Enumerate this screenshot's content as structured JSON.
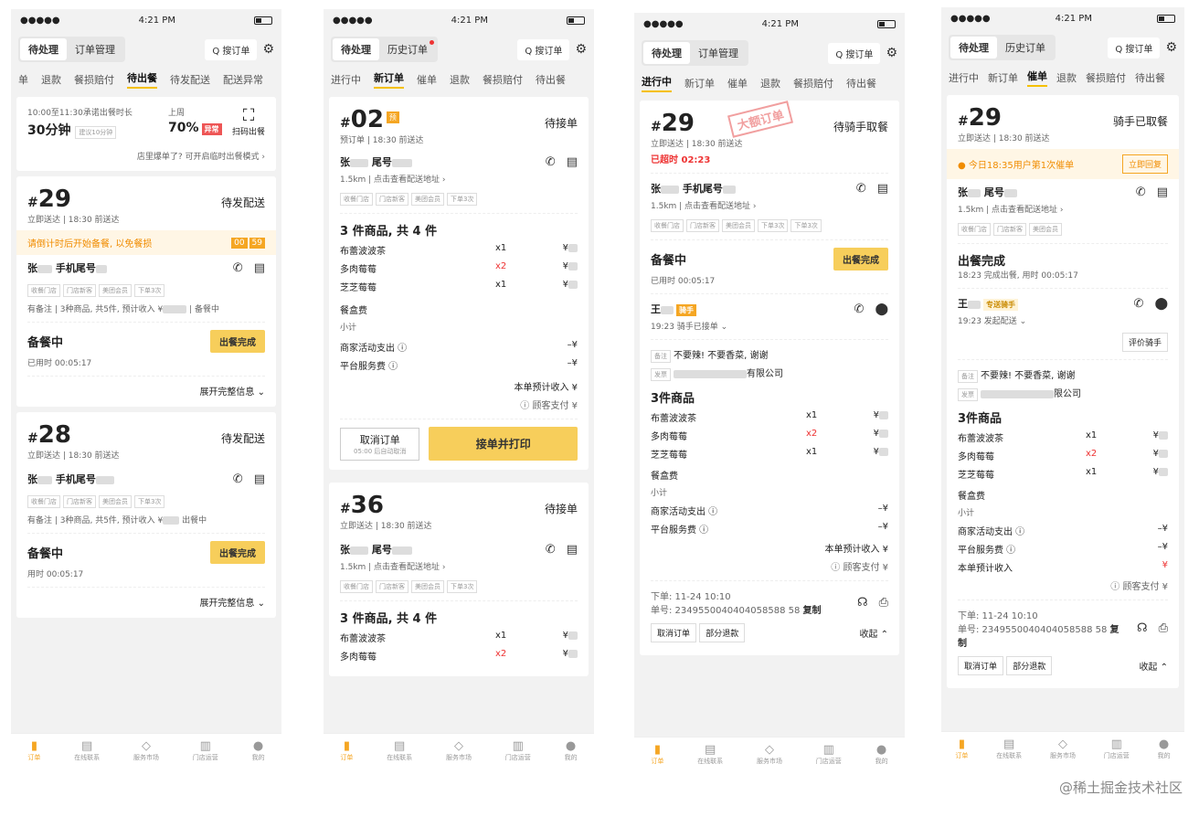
{
  "status": {
    "carrier": "●●●●●",
    "time": "4:21 PM"
  },
  "header": {
    "tab_pending": "待处理",
    "tab_orders": "订单管理",
    "tab_history": "历史订单",
    "search": "Q 搜订单",
    "gear": "⚙"
  },
  "nav": [
    "订单",
    "在线联系",
    "服务市场",
    "门店运营",
    "我的"
  ],
  "phone1": {
    "tabs": [
      "单",
      "退款",
      "餐损赔付",
      "待出餐",
      "待发配送",
      "配送异常"
    ],
    "promise_text": "10:00至11:30承诺出餐时长",
    "promise_value": "30分钟",
    "promise_suggest": "建议10分钟",
    "week_label": "上周",
    "week_value": "70%",
    "week_badge": "异常",
    "scan_label": "扫码出餐",
    "busy_text": "店里爆单了? 可开启临时出餐模式 ›",
    "order1": {
      "no": "29",
      "status": "待发配送",
      "sub": "立即送达 | 18:30 前送达",
      "warn": "请倒计时后开始备餐, 以免餐损",
      "t1": "00",
      "t2": "59",
      "name_a": "张",
      "name_b": "手机尾号",
      "tags": [
        "收餐门店",
        "门店新客",
        "美团会员",
        "下单3次"
      ],
      "note": "有备注 | 3种商品, 共5件, 预计收入 ¥",
      "note_tail": "| 备餐中",
      "prep": "备餐中",
      "prep_btn": "出餐完成",
      "elapsed": "已用时 00:05:17",
      "expand": "展开完整信息 ⌄"
    },
    "order2": {
      "no": "28",
      "status": "待发配送",
      "sub": "立即送达 | 18:30 前送达",
      "name_a": "张",
      "name_b": "手机尾号",
      "tags": [
        "收餐门店",
        "门店新客",
        "美团会员",
        "下单3次"
      ],
      "note": "有备注 | 3种商品, 共5件, 预计收入 ¥",
      "note_tail": "出餐中",
      "prep": "备餐中",
      "prep_btn": "出餐完成",
      "elapsed": "用时 00:05:17",
      "expand": "展开完整信息 ⌄"
    }
  },
  "phone2": {
    "tabs": [
      "进行中",
      "新订单",
      "催单",
      "退款",
      "餐损赔付",
      "待出餐"
    ],
    "order1": {
      "no": "02",
      "badge": "预",
      "status": "待接单",
      "sub": "预订单 | 18:30 前送达",
      "name_a": "张",
      "name_b": "尾号",
      "dist": "1.5km | 点击查看配送地址 ›",
      "tags": [
        "收餐门店",
        "门店新客",
        "美团会员",
        "下单3次"
      ],
      "goods_title": "3 件商品, 共 4 件",
      "goods": [
        {
          "n": "布蕾波波茶",
          "q": "x1"
        },
        {
          "n": "多肉莓莓",
          "q": "x2"
        },
        {
          "n": "芝芝莓莓",
          "q": "x1"
        }
      ],
      "box": "餐盒费",
      "subtotal": "小计",
      "activity": "商家活动支出 ⓘ",
      "service": "平台服务费 ⓘ",
      "income": "本单预计收入 ¥",
      "paid": "ⓘ 顾客支付 ¥",
      "cancel": "取消订单",
      "cancel_sub": "05:00 后自动取消",
      "accept": "接单并打印"
    },
    "order2": {
      "no": "36",
      "status": "待接单",
      "sub": "立即送达 | 18:30 前送达",
      "name_a": "张",
      "name_b": "尾号",
      "dist": "1.5km | 点击查看配送地址 ›",
      "tags": [
        "收餐门店",
        "门店新客",
        "美团会员",
        "下单3次"
      ],
      "goods_title": "3 件商品, 共 4 件",
      "goods": [
        {
          "n": "布蕾波波茶",
          "q": "x1"
        },
        {
          "n": "多肉莓莓",
          "q": "x2"
        }
      ]
    }
  },
  "phone3": {
    "tabs": [
      "进行中",
      "新订单",
      "催单",
      "退款",
      "餐损赔付",
      "待出餐"
    ],
    "no": "29",
    "stamp": "大额订单",
    "status": "待骑手取餐",
    "sub": "立即送达 | 18:30 前送达",
    "overtime": "已超时 02:23",
    "name_a": "张",
    "name_b": "手机尾号",
    "dist": "1.5km | 点击查看配送地址 ›",
    "tags": [
      "收餐门店",
      "门店新客",
      "美团会员",
      "下单3次",
      "下单3次"
    ],
    "prep": "备餐中",
    "prep_btn": "出餐完成",
    "elapsed": "已用时 00:05:17",
    "rider": "王",
    "rider_tag": "骑手",
    "rider_sub": "19:23 骑手已接单 ⌄",
    "note_label": "备注",
    "note": "不要辣! 不要香菜, 谢谢",
    "invoice_label": "发票",
    "invoice": "有限公司",
    "goods_title": "3件商品",
    "goods": [
      {
        "n": "布蕾波波茶",
        "q": "x1"
      },
      {
        "n": "多肉莓莓",
        "q": "x2"
      },
      {
        "n": "芝芝莓莓",
        "q": "x1"
      }
    ],
    "box": "餐盒费",
    "subtotal": "小计",
    "activity": "商家活动支出 ⓘ",
    "service": "平台服务费 ⓘ",
    "income": "本单预计收入 ¥",
    "paid": "ⓘ 顾客支付 ¥",
    "order_time": "下单: 11-24 10:10",
    "order_id": "单号: 2349550040404058588 58",
    "copy": "复制",
    "cancel": "取消订单",
    "refund": "部分退款",
    "collapse": "收起 ⌃"
  },
  "phone4": {
    "tabs": [
      "进行中",
      "新订单",
      "催单",
      "退款",
      "餐损赔付",
      "待出餐"
    ],
    "no": "29",
    "status": "骑手已取餐",
    "sub": "立即送达 | 18:30 前送达",
    "reminder": "今日18:35用户第1次催单",
    "reply": "立即回复",
    "name_a": "张",
    "name_b": "尾号",
    "dist": "1.5km | 点击查看配送地址 ›",
    "tags": [
      "收餐门店",
      "门店新客",
      "美团会员"
    ],
    "done": "出餐完成",
    "done_sub": "18:23 完成出餐, 用时 00:05:17",
    "rider": "王",
    "rider_tag": "专送骑手",
    "rider_sub": "19:23 发起配送 ⌄",
    "rate": "评价骑手",
    "note_label": "备注",
    "note": "不要辣! 不要香菜, 谢谢",
    "invoice_label": "发票",
    "invoice": "限公司",
    "goods_title": "3件商品",
    "goods": [
      {
        "n": "布蕾波波茶",
        "q": "x1"
      },
      {
        "n": "多肉莓莓",
        "q": "x2"
      },
      {
        "n": "芝芝莓莓",
        "q": "x1"
      }
    ],
    "box": "餐盒费",
    "subtotal": "小计",
    "activity": "商家活动支出 ⓘ",
    "service": "平台服务费 ⓘ",
    "income": "本单预计收入",
    "paid": "ⓘ 顾客支付 ¥",
    "order_time": "下单: 11-24 10:10",
    "order_id": "单号: 2349550040404058588 58",
    "copy": "复制",
    "cancel": "取消订单",
    "refund": "部分退款",
    "collapse": "收起 ⌃"
  },
  "watermark": "@稀土掘金技术社区"
}
